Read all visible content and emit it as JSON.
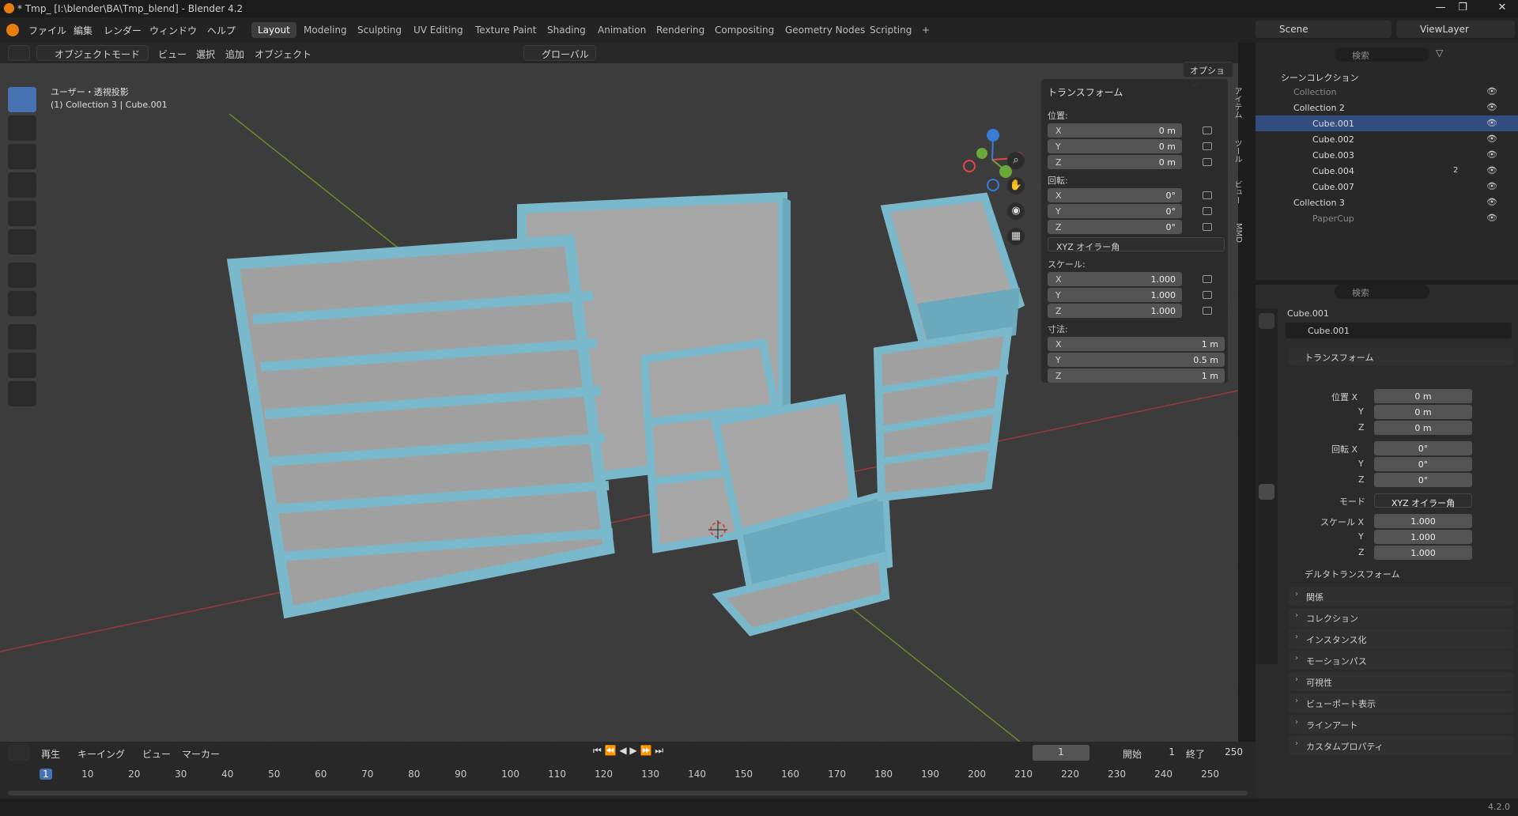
{
  "window": {
    "title": "* Tmp_ [I:\\blender\\BA\\Tmp_blend] - Blender 4.2"
  },
  "menu": [
    "ファイル",
    "編集",
    "レンダー",
    "ウィンドウ",
    "ヘルプ"
  ],
  "workspaces": [
    "Layout",
    "Modeling",
    "Sculpting",
    "UV Editing",
    "Texture Paint",
    "Shading",
    "Animation",
    "Rendering",
    "Compositing",
    "Geometry Nodes",
    "Scripting"
  ],
  "active_workspace": "Layout",
  "scene": {
    "label": "Scene",
    "view_layer": "ViewLayer"
  },
  "viewport": {
    "mode": "オブジェクトモード",
    "menus": [
      "ビュー",
      "選択",
      "追加",
      "オブジェクト"
    ],
    "transform_orientation": "グローバル",
    "options_label": "オプション",
    "overlay_title": "ユーザー・透視投影",
    "overlay_subtitle": "(1) Collection 3 | Cube.001"
  },
  "npanel": {
    "section": "トランスフォーム",
    "location_label": "位置:",
    "location": [
      {
        "axis": "X",
        "value": "0 m"
      },
      {
        "axis": "Y",
        "value": "0 m"
      },
      {
        "axis": "Z",
        "value": "0 m"
      }
    ],
    "rotation_label": "回転:",
    "rotation": [
      {
        "axis": "X",
        "value": "0°"
      },
      {
        "axis": "Y",
        "value": "0°"
      },
      {
        "axis": "Z",
        "value": "0°"
      }
    ],
    "rotation_mode": "XYZ オイラー角",
    "scale_label": "スケール:",
    "scale": [
      {
        "axis": "X",
        "value": "1.000"
      },
      {
        "axis": "Y",
        "value": "1.000"
      },
      {
        "axis": "Z",
        "value": "1.000"
      }
    ],
    "dimensions_label": "寸法:",
    "dimensions": [
      {
        "axis": "X",
        "value": "1 m"
      },
      {
        "axis": "Y",
        "value": "0.5 m"
      },
      {
        "axis": "Z",
        "value": "1 m"
      }
    ],
    "side_tabs": [
      "アイテム",
      "ツール",
      "ビュー",
      "MMD"
    ]
  },
  "outliner": {
    "search_placeholder": "検索",
    "root": "シーンコレクション",
    "rows": [
      {
        "label": "Collection",
        "indent": 1,
        "dim": true
      },
      {
        "label": "Collection 2",
        "indent": 1,
        "dim": false
      },
      {
        "label": "Cube.001",
        "indent": 2,
        "dim": false
      },
      {
        "label": "Cube.002",
        "indent": 2,
        "dim": false
      },
      {
        "label": "Cube.003",
        "indent": 2,
        "dim": false
      },
      {
        "label": "Cube.004",
        "indent": 2,
        "dim": false,
        "badge": "2"
      },
      {
        "label": "Cube.007",
        "indent": 2,
        "dim": false
      },
      {
        "label": "Collection 3",
        "indent": 1,
        "dim": false
      },
      {
        "label": "PaperCup",
        "indent": 2,
        "dim": true
      }
    ]
  },
  "properties": {
    "search_placeholder": "検索",
    "object_name": "Cube.001",
    "object_field": "Cube.001",
    "transform_section": "トランスフォーム",
    "location_label": "位置 X",
    "location": [
      "0 m",
      "0 m",
      "0 m"
    ],
    "rotation_label": "回転 X",
    "rotation": [
      "0°",
      "0°",
      "0°"
    ],
    "mode_label": "モード",
    "mode_value": "XYZ オイラー角",
    "scale_label": "スケール X",
    "scale": [
      "1.000",
      "1.000",
      "1.000"
    ],
    "axis_y": "Y",
    "axis_z": "Z",
    "delta": "デルタトランスフォーム",
    "panels": [
      "関係",
      "コレクション",
      "インスタンス化",
      "モーションパス",
      "可視性",
      "ビューポート表示",
      "ラインアート",
      "カスタムプロパティ"
    ]
  },
  "timeline": {
    "menus": [
      "再生",
      "キーイング",
      "ビュー",
      "マーカー"
    ],
    "current_frame": "1",
    "start_label": "開始",
    "start": "1",
    "end_label": "終了",
    "end": "250",
    "ticks": [
      "1",
      "10",
      "20",
      "30",
      "40",
      "50",
      "60",
      "70",
      "80",
      "90",
      "100",
      "110",
      "120",
      "130",
      "140",
      "150",
      "160",
      "170",
      "180",
      "190",
      "200",
      "210",
      "220",
      "230",
      "240",
      "250"
    ]
  },
  "status": {
    "version": "4.2.0"
  },
  "colors": {
    "accent": "#4772b3",
    "mesh_outline": "#7ab9cc",
    "mesh_face": "#a8a8a8",
    "selected_row": "#334d80"
  }
}
